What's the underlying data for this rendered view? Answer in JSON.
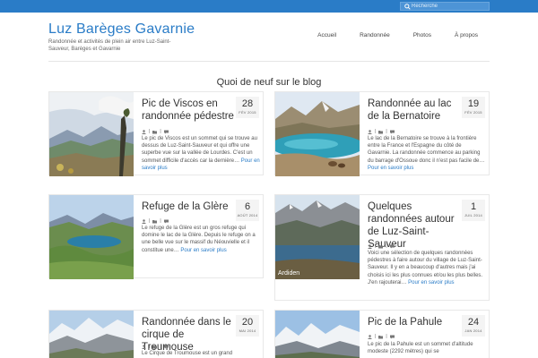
{
  "header": {
    "site_title": "Luz Barèges Gavarnie",
    "tagline": "Randonnée et activités de plein air entre Luz-Saint-Sauveur, Barèges et Gavarnie",
    "search_placeholder": "Recherche"
  },
  "nav": [
    "Accueil",
    "Randonnée",
    "Photos",
    "À propos"
  ],
  "blog": {
    "title": "Quoi de neuf sur le blog",
    "read_more": "Pour en savoir plus",
    "meta_sep": "|",
    "posts": [
      {
        "title": "Pic de Viscos en randonnée pédestre",
        "day": "28",
        "month": "FÉV 2015",
        "excerpt": "Le pic de Viscos est un sommet qui se trouve au dessus de Luz-Saint-Sauveur et qui offre une superbe vue sur la vallée de Lourdes. C'est un sommet difficile d'accès car la dernière…"
      },
      {
        "title": "Randonnée au lac de la Bernatoire",
        "day": "19",
        "month": "FÉV 2015",
        "excerpt": "Le lac de la Bernatoire se trouve à la frontière entre la France et l'Espagne du côté de Gavarnie. La randonnée commence au parking du barrage d'Ossoue donc il n'est pas facile de…"
      },
      {
        "title": "Refuge de la Glère",
        "day": "6",
        "month": "AOÛT 2014",
        "excerpt": "Le refuge de la Glère est un gros refuge qui domine le lac de la Glère. Depuis le refuge on a une belle vue sur le massif du Néouvielle et il constitue une…"
      },
      {
        "title": "Quelques randonnées autour de Luz-Saint-Sauveur",
        "day": "1",
        "month": "JUIL 2014",
        "excerpt": "Voici une sélection de quelques randonnées pédestres à faire autour du village de Luz-Saint-Sauveur. Il y en a beaucoup d'autres mais j'ai choisis ici les plus connues et/ou les plus belles. J'en rajouterai…",
        "image_caption": "Ardiden"
      },
      {
        "title": "Randonnée dans le cirque de Troumouse",
        "day": "20",
        "month": "MAI 2014",
        "excerpt": "Le Cirque de Troumouse est un grand"
      },
      {
        "title": "Pic de la Pahule",
        "day": "24",
        "month": "JAN 2014",
        "excerpt": "Le pic de la Pahule est un sommet d'altitude modeste (2292 mètres) qui se"
      }
    ]
  },
  "colors": {
    "accent": "#2a7cc7",
    "topbar": "#2a7cc7"
  },
  "icons": [
    "search-icon",
    "user-icon",
    "folder-icon",
    "comment-icon"
  ]
}
